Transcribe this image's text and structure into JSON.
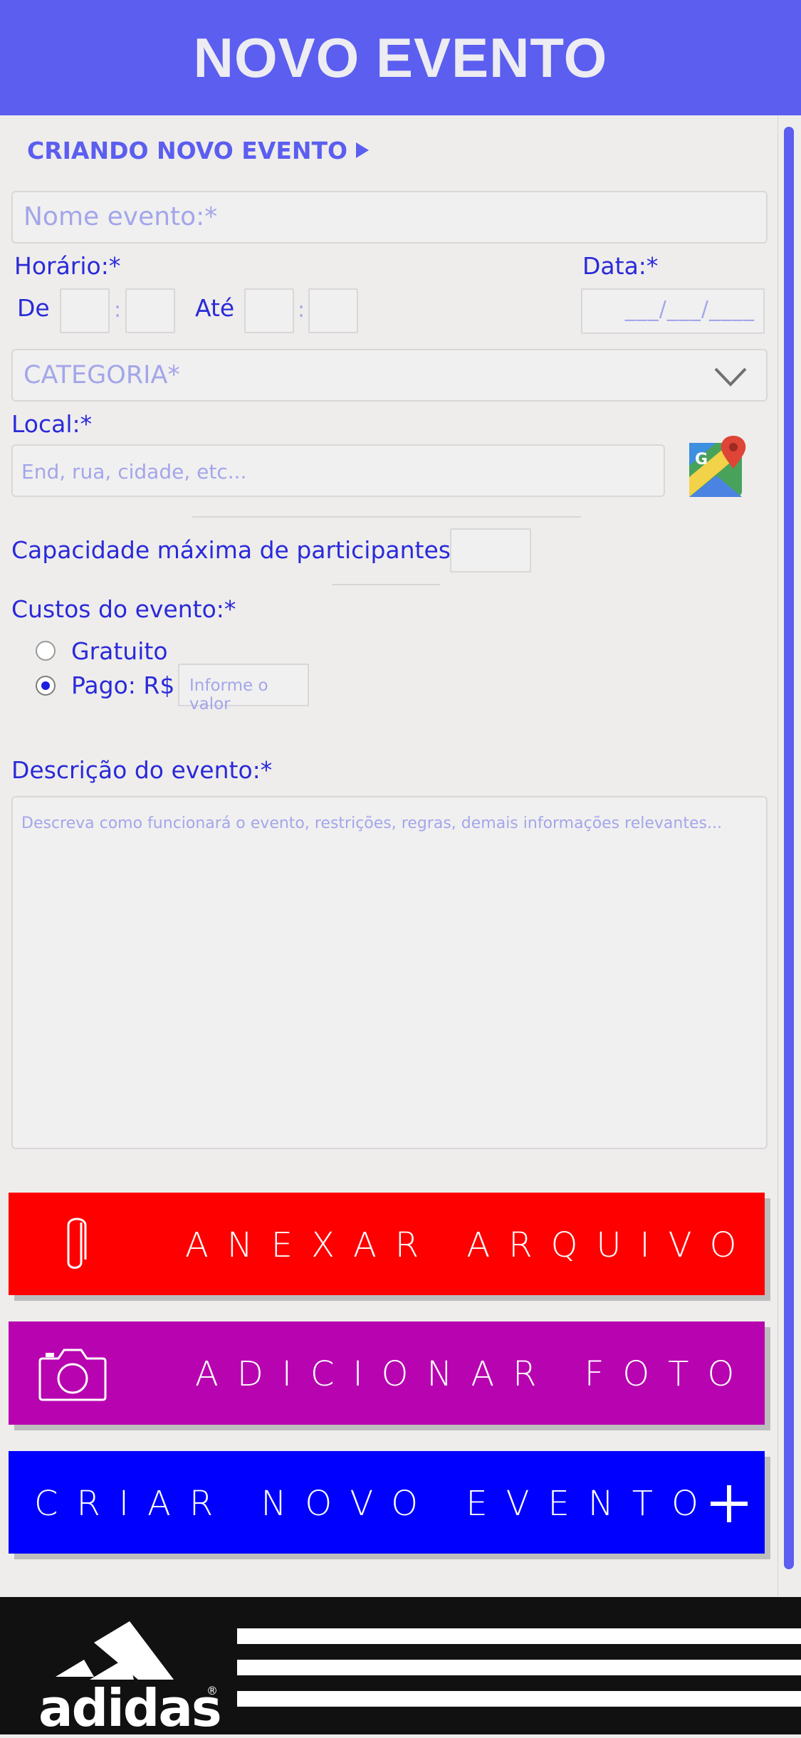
{
  "header": {
    "title": "NOVO EVENTO"
  },
  "section": {
    "title": "CRIANDO NOVO EVENTO"
  },
  "form": {
    "name_placeholder": "Nome evento:*",
    "time_label": "Horário:*",
    "from_label": "De",
    "to_label": "Até",
    "colon": ":",
    "date_label": "Data:*",
    "date_placeholder": "___/___/____",
    "category_placeholder": "CATEGORIA*",
    "location_label": "Local:*",
    "location_placeholder": "End, rua, cidade, etc...",
    "capacity_label": "Capacidade máxima de participantes:",
    "costs_label": "Custos do evento:*",
    "free_label": "Gratuito",
    "paid_label": "Pago: R$",
    "paid_placeholder": "Informe o valor",
    "paid_selected": true,
    "description_label": "Descrição do evento:*",
    "description_placeholder": "Descreva como funcionará o evento, restrições, regras, demais informações relevantes..."
  },
  "buttons": {
    "attach": "ANEXAR ARQUIVO",
    "photo": "ADICIONAR FOTO",
    "create": "CRIAR NOVO EVENTO"
  },
  "colors": {
    "accent": "#5b5eef",
    "attach": "#ff0000",
    "photo": "#b704b0",
    "create": "#0000ff"
  },
  "icons": {
    "section": "play-triangle-icon",
    "dropdown": "chevron-down-icon",
    "maps": "google-maps-icon",
    "attach": "paperclip-icon",
    "photo": "camera-icon",
    "create": "plus-icon"
  },
  "footer": {
    "brand": "adidas",
    "trademark": "®"
  }
}
